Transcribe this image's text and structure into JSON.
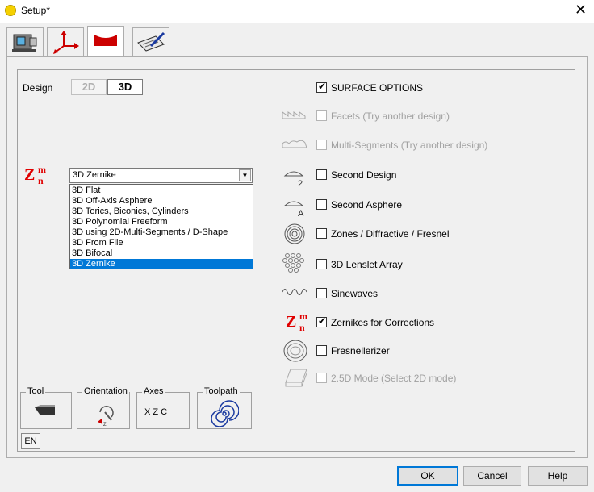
{
  "window": {
    "title": "Setup*"
  },
  "tabs": [
    {
      "icon": "machine-icon"
    },
    {
      "icon": "axes-icon"
    },
    {
      "icon": "lens-icon",
      "active": true
    },
    {
      "icon": "notepad-icon"
    }
  ],
  "design": {
    "label": "Design",
    "btn_2d": "2D",
    "btn_3d": "3D"
  },
  "surface_type": {
    "symbol_main": "Z",
    "symbol_sup": "m",
    "symbol_sub": "n",
    "selected": "3D Zernike",
    "options": [
      "3D Flat",
      "3D Off-Axis Asphere",
      "3D Torics, Biconics, Cylinders",
      "3D Polynomial Freeform",
      "3D using 2D-Multi-Segments / D-Shape",
      "3D From File",
      "3D Bifocal",
      "3D Zernike"
    ]
  },
  "surface_options": {
    "header": "SURFACE OPTIONS",
    "header_checked": true,
    "items": [
      {
        "label": "Facets (Try another design)",
        "checked": false,
        "enabled": false,
        "icon": "facets-icon"
      },
      {
        "label": "Multi-Segments  (Try another design)",
        "checked": false,
        "enabled": false,
        "icon": "multi-segments-icon"
      },
      {
        "label": "Second Design",
        "checked": false,
        "enabled": true,
        "icon": "second-design-icon",
        "icon_text": "2"
      },
      {
        "label": "Second Asphere",
        "checked": false,
        "enabled": true,
        "icon": "second-asphere-icon",
        "icon_text": "A"
      },
      {
        "label": "Zones / Diffractive / Fresnel",
        "checked": false,
        "enabled": true,
        "icon": "zones-icon"
      },
      {
        "label": "3D Lenslet Array",
        "checked": false,
        "enabled": true,
        "icon": "lenslet-icon"
      },
      {
        "label": "Sinewaves",
        "checked": false,
        "enabled": true,
        "icon": "sinewave-icon"
      },
      {
        "label": "Zernikes for Corrections",
        "checked": true,
        "enabled": true,
        "icon": "zernike-icon"
      },
      {
        "label": "Fresnellerizer",
        "checked": false,
        "enabled": true,
        "icon": "fresnellerizer-icon"
      },
      {
        "label": "2.5D Mode  (Select 2D mode)",
        "checked": false,
        "enabled": false,
        "icon": "mode-25d-icon"
      }
    ]
  },
  "groups": {
    "tool": {
      "label": "Tool"
    },
    "orientation": {
      "label": "Orientation"
    },
    "axes": {
      "label": "Axes",
      "value": "X Z C"
    },
    "toolpath": {
      "label": "Toolpath"
    }
  },
  "language_button": "EN",
  "buttons": {
    "ok": "OK",
    "cancel": "Cancel",
    "help": "Help"
  },
  "colors": {
    "accent": "#0078d7",
    "zernike_red": "#e00000",
    "icon_red": "#cc0000"
  }
}
